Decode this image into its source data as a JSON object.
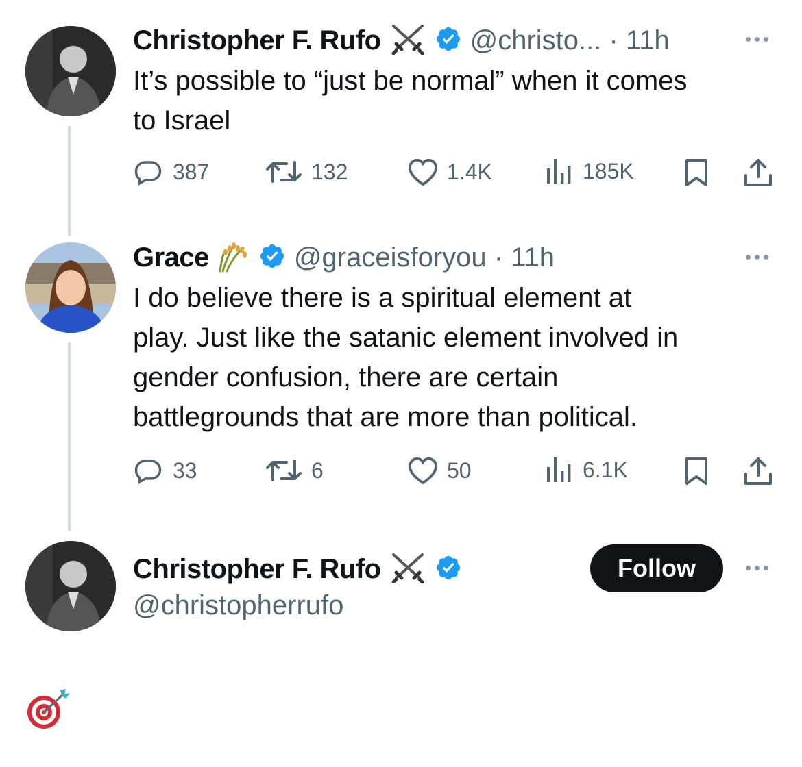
{
  "colors": {
    "verified": "#1d9bf0",
    "secondary_text": "#536471",
    "thread_line": "#cfd9de"
  },
  "tweet1": {
    "name": "Christopher F. Rufo",
    "name_emoji_icon": "crossed-swords-icon",
    "handle": "@christo... · 11h",
    "text_line1": "It’s possible to “just be normal” when it comes",
    "text_line2": "to Israel",
    "replies": "387",
    "retweets": "132",
    "likes": "1.4K",
    "views": "185K"
  },
  "tweet2": {
    "name": "Grace",
    "name_emoji_icon": "sheaf-of-rice-icon",
    "handle": "@graceisforyou · 11h",
    "text_line1": "I do believe there is a spiritual element at",
    "text_line2": "play. Just like the satanic element involved in",
    "text_line3": "gender confusion, there are certain",
    "text_line4": "battlegrounds that are more than political.",
    "replies": "33",
    "retweets": "6",
    "likes": "50",
    "views": "6.1K"
  },
  "tweet3": {
    "name": "Christopher F. Rufo",
    "name_emoji_icon": "crossed-swords-icon",
    "handle": "@christopherrufo",
    "follow_label": "Follow",
    "reply_emoji_icon": "direct-hit-target-icon"
  }
}
